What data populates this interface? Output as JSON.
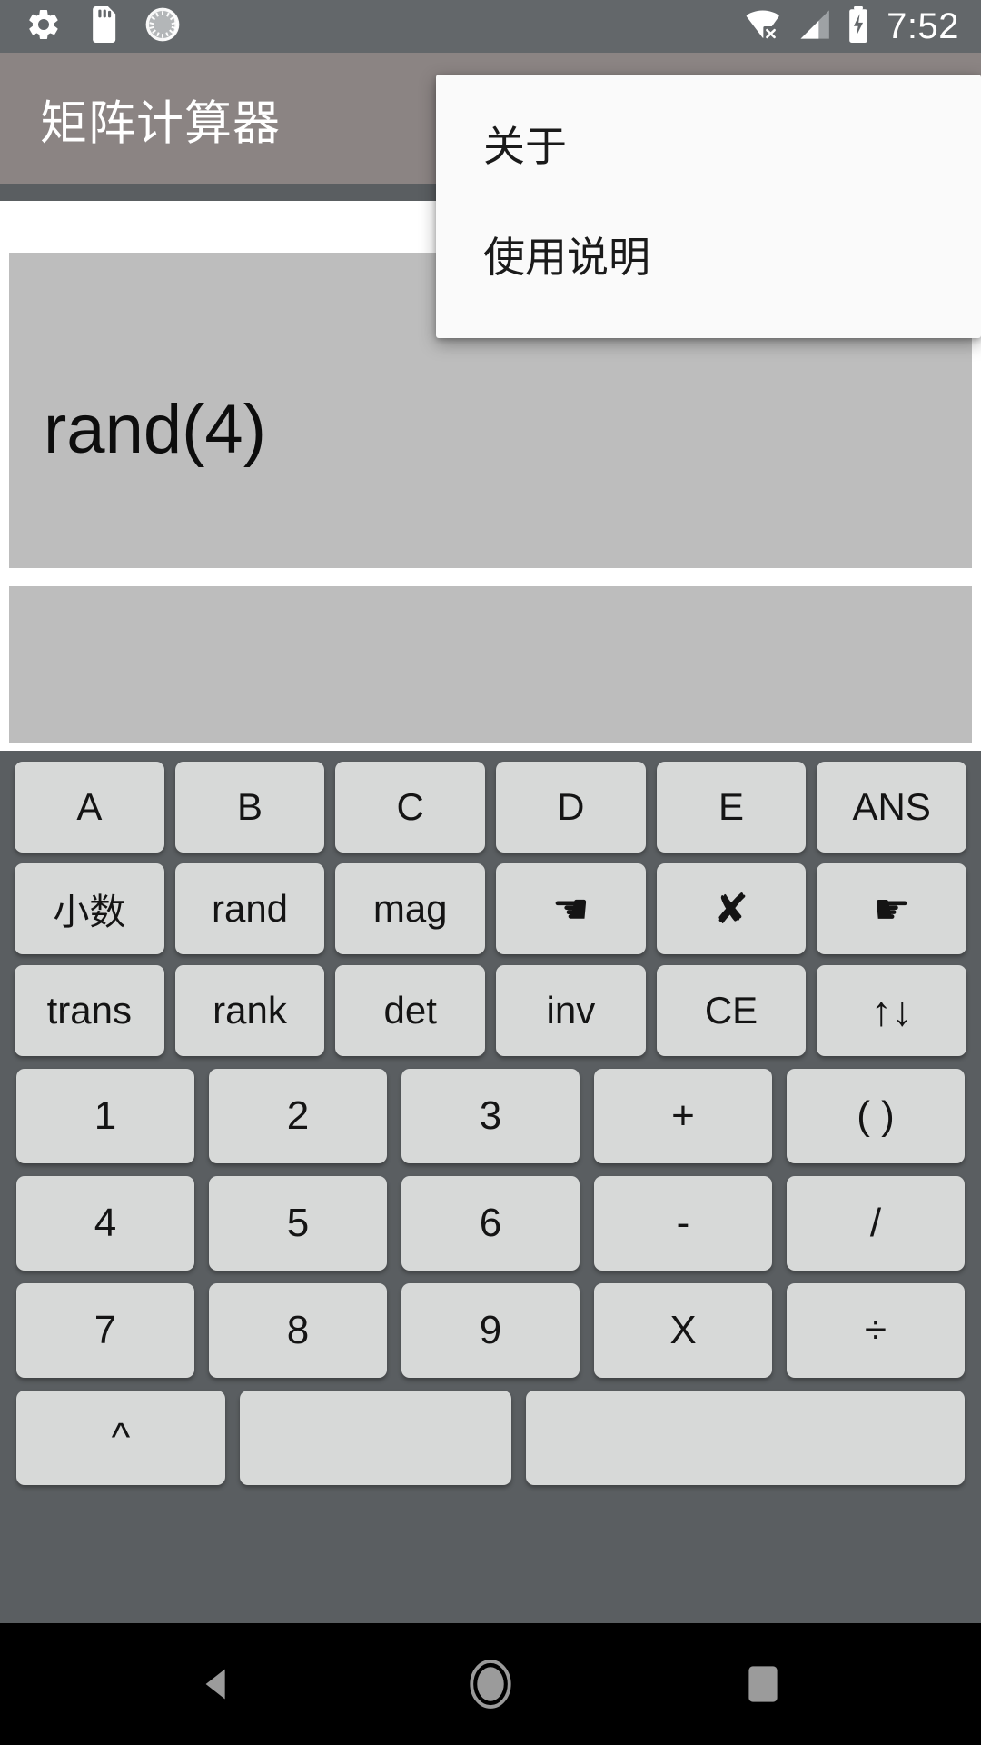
{
  "statusbar": {
    "time": "7:52",
    "icons": [
      {
        "name": "settings-gear-icon"
      },
      {
        "name": "sd-card-icon"
      },
      {
        "name": "sync-circle-icon"
      },
      {
        "name": "wifi-no-internet-icon"
      },
      {
        "name": "cellular-signal-icon"
      },
      {
        "name": "battery-charging-icon"
      }
    ]
  },
  "appbar": {
    "title": "矩阵计算器"
  },
  "popup_menu": {
    "items": [
      {
        "label": "关于"
      },
      {
        "label": "使用说明"
      }
    ]
  },
  "display": {
    "input_value": "rand(4)",
    "result_value": ""
  },
  "keypad": {
    "rows": [
      {
        "style": "a",
        "keys": [
          {
            "label": "A",
            "name": "key-matrix-a"
          },
          {
            "label": "B",
            "name": "key-matrix-b"
          },
          {
            "label": "C",
            "name": "key-matrix-c"
          },
          {
            "label": "D",
            "name": "key-matrix-d"
          },
          {
            "label": "E",
            "name": "key-matrix-e"
          },
          {
            "label": "ANS",
            "name": "key-ans"
          }
        ]
      },
      {
        "style": "a",
        "keys": [
          {
            "label": "小数",
            "name": "key-decimal",
            "cls": "cjk"
          },
          {
            "label": "rand",
            "name": "key-rand"
          },
          {
            "label": "mag",
            "name": "key-mag"
          },
          {
            "label": "☚",
            "name": "key-cursor-left-icon",
            "cls": "glyph"
          },
          {
            "label": "✘",
            "name": "key-delete-icon",
            "cls": "glyph"
          },
          {
            "label": "☛",
            "name": "key-cursor-right-icon",
            "cls": "glyph"
          }
        ]
      },
      {
        "style": "a",
        "keys": [
          {
            "label": "trans",
            "name": "key-transpose"
          },
          {
            "label": "rank",
            "name": "key-rank"
          },
          {
            "label": "det",
            "name": "key-determinant"
          },
          {
            "label": "inv",
            "name": "key-inverse"
          },
          {
            "label": "CE",
            "name": "key-clear-entry"
          },
          {
            "label": "↑↓",
            "name": "key-swap-arrows-icon",
            "cls": "glyph"
          }
        ]
      },
      {
        "style": "b",
        "keys": [
          {
            "label": "1",
            "name": "key-1"
          },
          {
            "label": "2",
            "name": "key-2"
          },
          {
            "label": "3",
            "name": "key-3"
          },
          {
            "label": "+",
            "name": "key-plus"
          },
          {
            "label": "( )",
            "name": "key-parentheses"
          }
        ]
      },
      {
        "style": "b",
        "keys": [
          {
            "label": "4",
            "name": "key-4"
          },
          {
            "label": "5",
            "name": "key-5"
          },
          {
            "label": "6",
            "name": "key-6"
          },
          {
            "label": "-",
            "name": "key-minus"
          },
          {
            "label": "/",
            "name": "key-slash"
          }
        ]
      },
      {
        "style": "b",
        "keys": [
          {
            "label": "7",
            "name": "key-7"
          },
          {
            "label": "8",
            "name": "key-8"
          },
          {
            "label": "9",
            "name": "key-9"
          },
          {
            "label": "X",
            "name": "key-multiply-x"
          },
          {
            "label": "÷",
            "name": "key-divide"
          }
        ]
      },
      {
        "style": "c",
        "keys": [
          {
            "label": "^",
            "name": "key-power",
            "cls": "w1"
          },
          {
            "label": "",
            "name": "key-blank-1",
            "cls": "w2"
          },
          {
            "label": "",
            "name": "key-blank-2",
            "cls": "w3"
          }
        ]
      }
    ]
  },
  "navbar": {
    "buttons": [
      {
        "name": "nav-back-icon"
      },
      {
        "name": "nav-home-icon"
      },
      {
        "name": "nav-recents-icon"
      }
    ]
  },
  "colors": {
    "status_bar": "#63676a",
    "app_bar": "#8b8483",
    "keypad_bg": "#5a5e61",
    "key_face": "#d7d9d8",
    "display_panel": "#bdbdbd",
    "popup_bg": "#fafafa",
    "nav_bar": "#000000"
  }
}
